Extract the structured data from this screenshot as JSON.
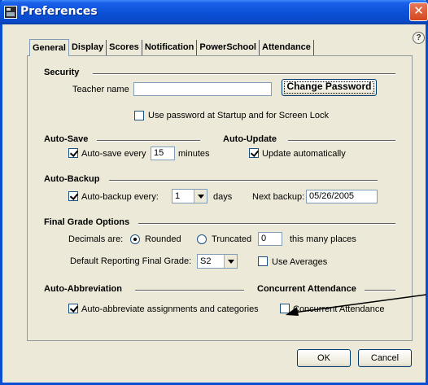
{
  "window": {
    "title": "Preferences",
    "close_glyph": "✕",
    "help_glyph": "?"
  },
  "tabs": [
    {
      "label": "General"
    },
    {
      "label": "Display"
    },
    {
      "label": "Scores"
    },
    {
      "label": "Notification"
    },
    {
      "label": "PowerSchool"
    },
    {
      "label": "Attendance"
    }
  ],
  "security": {
    "heading": "Security",
    "teacher_name_label": "Teacher name",
    "teacher_name_value": "",
    "change_password_label": "Change Password",
    "use_password_label": "Use password at Startup and for Screen Lock"
  },
  "auto_save": {
    "heading": "Auto-Save",
    "label_before": "Auto-save every",
    "minutes_value": "15",
    "label_after": "minutes"
  },
  "auto_update": {
    "heading": "Auto-Update",
    "label": "Update automatically"
  },
  "auto_backup": {
    "heading": "Auto-Backup",
    "label_before": "Auto-backup every:",
    "days_value": "1",
    "label_after": "days",
    "next_backup_label": "Next backup:",
    "next_backup_value": "05/26/2005"
  },
  "final_grade": {
    "heading": "Final Grade Options",
    "decimals_label": "Decimals are:",
    "rounded_label": "Rounded",
    "truncated_label": "Truncated",
    "places_value": "0",
    "places_label": "this many places",
    "default_label": "Default Reporting Final Grade:",
    "default_value": "S2",
    "use_averages_label": "Use Averages"
  },
  "auto_abbreviation": {
    "heading": "Auto-Abbreviation",
    "label": "Auto-abbreviate assignments and categories"
  },
  "concurrent": {
    "heading": "Concurrent Attendance",
    "label": "Concurrent Attendance"
  },
  "buttons": {
    "ok": "OK",
    "cancel": "Cancel"
  },
  "colors": {
    "titlebar": "#0b52d8",
    "dialog_bg": "#ece9d8",
    "close": "#d4471e"
  }
}
